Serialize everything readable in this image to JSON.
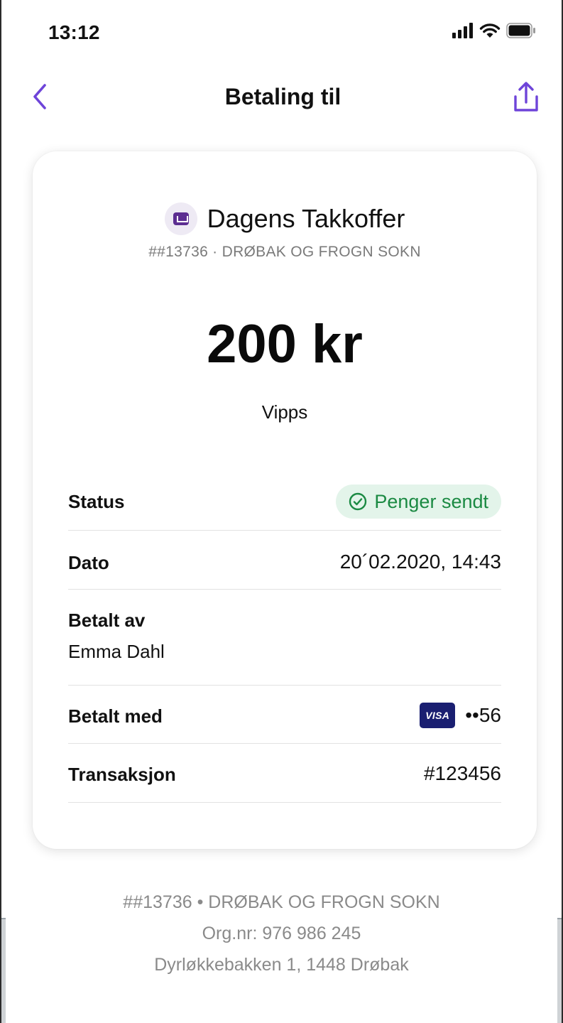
{
  "status_bar": {
    "time": "13:12",
    "signal_icon": "cellular-signal-icon",
    "wifi_icon": "wifi-icon",
    "battery_icon": "battery-icon"
  },
  "nav": {
    "title": "Betaling til",
    "back_icon": "chevron-left-icon",
    "share_icon": "share-icon",
    "accent_color": "#6e44d9"
  },
  "merchant": {
    "name": "Dagens Takkoffer",
    "subtitle": "##13736 · DRØBAK OG FROGN SOKN",
    "logo_icon": "merchant-logo-icon"
  },
  "payment": {
    "amount": "200 kr",
    "method": "Vipps"
  },
  "details": {
    "status_label": "Status",
    "status_value": "Penger sendt",
    "status_color": "#1b8a43",
    "date_label": "Dato",
    "date_value": "20´02.2020, 14:43",
    "payer_label": "Betalt av",
    "payer_value": "Emma Dahl",
    "paid_with_label": "Betalt med",
    "card_brand": "VISA",
    "card_last_digits": "••56",
    "transaction_label": "Transaksjon",
    "transaction_value": "#123456"
  },
  "footer": {
    "line1": "##13736 • DRØBAK OG FROGN SOKN",
    "line2": "Org.nr: 976 986 245",
    "line3": "Dyrløkkebakken 1, 1448 Drøbak"
  }
}
